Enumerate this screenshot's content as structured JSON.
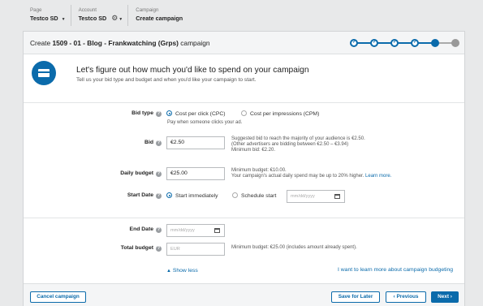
{
  "breadcrumb": [
    {
      "label": "Page",
      "value": "Testco SD"
    },
    {
      "label": "Account",
      "value": "Testco SD"
    },
    {
      "label": "Campaign",
      "value": "Create campaign"
    }
  ],
  "header": {
    "prefix": "Create ",
    "campaign_name": "1509 - 01 - Blog - Frankwatching (Grps)",
    "suffix": " campaign"
  },
  "progress": {
    "completed_steps": 4,
    "current_step": 5,
    "total_steps": 6
  },
  "intro": {
    "heading": "Let's figure out how much you'd like to spend on your campaign",
    "subtext": "Tell us your bid type and budget and when you'd like your campaign to start."
  },
  "form": {
    "bid_type": {
      "label": "Bid type",
      "options": [
        "Cost per click (CPC)",
        "Cost per impressions (CPM)"
      ],
      "selected": "Cost per click (CPC)",
      "hint": "Pay when someone clicks your ad."
    },
    "bid": {
      "label": "Bid",
      "value": "€2.50",
      "note1": "Suggested bid to reach the majority of your audience is €2.50.",
      "note2": "(Other advertisers are bidding between €2.50 – €3.94)",
      "note3": "Minimum bid: €2.20."
    },
    "daily_budget": {
      "label": "Daily budget",
      "value": "€25.00",
      "note1": "Minimum budget: €10.00.",
      "note2": "Your campaign's actual daily spend may be up to 20% higher.",
      "link": "Learn more."
    },
    "start_date": {
      "label": "Start Date",
      "options": [
        "Start immediately",
        "Schedule start"
      ],
      "selected": "Start immediately",
      "placeholder": "mm/dd/yyyy"
    },
    "end_date": {
      "label": "End Date",
      "placeholder": "mm/dd/yyyy"
    },
    "total_budget": {
      "label": "Total budget",
      "placeholder": "EUR",
      "note": "Minimum budget: €25.00 (includes amount already spent)."
    },
    "show_less": "Show less",
    "learn_more_link": "I want to learn more about campaign budgeting"
  },
  "footer": {
    "cancel": "Cancel campaign",
    "save": "Save for Later",
    "previous": "‹ Previous",
    "next": "Next ›"
  },
  "icons": {
    "help": "help-icon",
    "gear": "gear-icon",
    "calendar": "calendar-icon",
    "credit_card": "credit-card-icon"
  },
  "colors": {
    "accent": "#0b6bab",
    "background": "#e8e9ea",
    "card": "#ffffff"
  }
}
